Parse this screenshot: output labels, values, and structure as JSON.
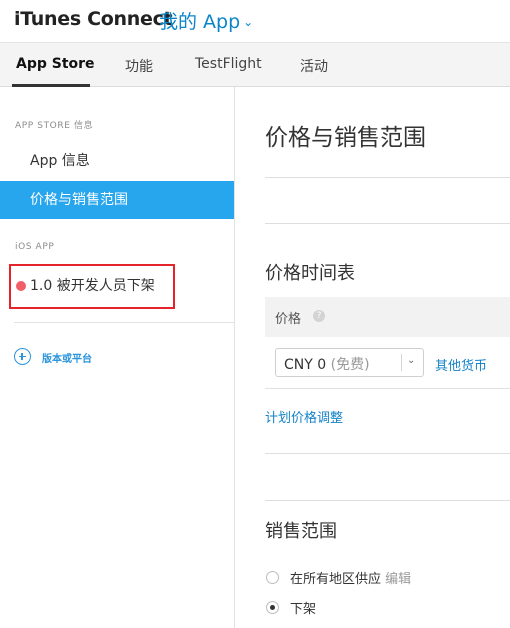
{
  "header": {
    "brand": "iTunes Connect",
    "app_menu": "我的 App",
    "app_menu_icon": "chevron-down-icon"
  },
  "tabs": [
    {
      "label": "App Store",
      "active": true
    },
    {
      "label": "功能"
    },
    {
      "label": "TestFlight"
    },
    {
      "label": "活动"
    }
  ],
  "sidebar": {
    "section_app_store": "APP STORE 信息",
    "items": [
      {
        "label": "App 信息"
      },
      {
        "label": "价格与销售范围",
        "active": true
      }
    ],
    "section_ios": "iOS APP",
    "version": {
      "label": "1.0 被开发人员下架",
      "status_color": "#f25d67"
    },
    "add_label": "版本或平台",
    "add_icon": "plus-circle-icon"
  },
  "main": {
    "title": "价格与销售范围",
    "price_schedule": {
      "title": "价格时间表",
      "column_header": "价格",
      "help_icon": "?",
      "price_value": "CNY 0",
      "price_note": "(免费)",
      "other_currencies": "其他货币",
      "plan_adjust": "计划价格调整"
    },
    "availability": {
      "title": "销售范围",
      "option_all": "在所有地区供应",
      "edit": "编辑",
      "option_remove": "下架",
      "selected": "下架"
    }
  },
  "colors": {
    "accent": "#27a5ed",
    "link": "#1583c7",
    "highlight_box": "#e4232b"
  }
}
